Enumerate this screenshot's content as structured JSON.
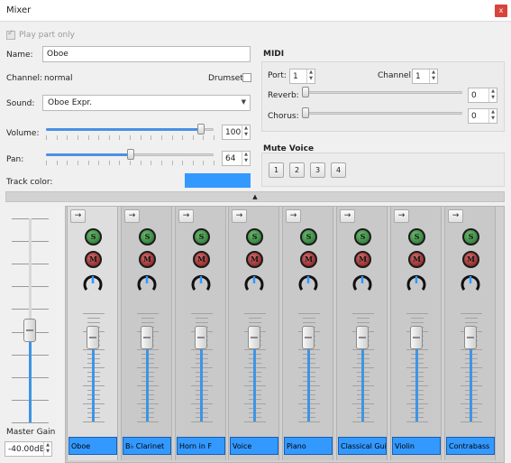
{
  "window": {
    "title": "Mixer",
    "close_glyph": "x"
  },
  "play_part_only": {
    "label": "Play part only",
    "checked": true
  },
  "name": {
    "label": "Name:",
    "value": "Oboe"
  },
  "channel": {
    "label": "Channel:",
    "value": "normal"
  },
  "drumset": {
    "label": "Drumset",
    "checked": false
  },
  "sound": {
    "label": "Sound:",
    "value": "Oboe Expr."
  },
  "volume": {
    "label": "Volume:",
    "value": "100",
    "level": 0.92
  },
  "pan": {
    "label": "Pan:",
    "value": "64",
    "level": 0.5
  },
  "track_color": {
    "label": "Track color:",
    "color": "#3399ff"
  },
  "midi": {
    "title": "MIDI",
    "port_label": "Port:",
    "port_value": "1",
    "channel_label": "Channel:",
    "channel_value": "1",
    "reverb_label": "Reverb:",
    "reverb_value": "0",
    "chorus_label": "Chorus:",
    "chorus_value": "0"
  },
  "mute_voice": {
    "title": "Mute Voice",
    "voices": [
      "1",
      "2",
      "3",
      "4"
    ]
  },
  "collapse_glyph": "▲",
  "master": {
    "label": "Master Gain",
    "value": "-40.00dB",
    "level": 0.45
  },
  "strip_common": {
    "arrow": "→",
    "solo": "S",
    "mute": "M"
  },
  "strips": [
    {
      "name": "Oboe",
      "active": true
    },
    {
      "name": "B♭ Clarinet",
      "active": false
    },
    {
      "name": "Horn in F",
      "active": false
    },
    {
      "name": "Voice",
      "active": false
    },
    {
      "name": "Piano",
      "active": false
    },
    {
      "name": "Classical Guitar",
      "active": false
    },
    {
      "name": "Violin",
      "active": false
    },
    {
      "name": "Contrabass",
      "active": false
    }
  ],
  "colors": {
    "accent": "#3399ff",
    "slider_fill": "#4a90e2",
    "close": "#d9433b"
  }
}
